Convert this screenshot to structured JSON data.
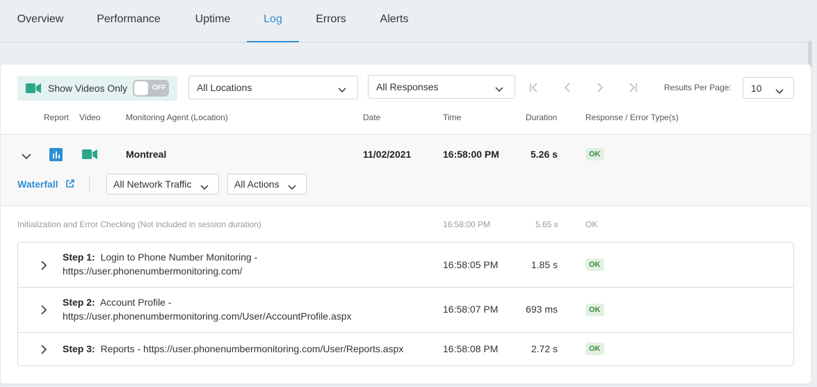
{
  "tabs": [
    {
      "label": "Overview"
    },
    {
      "label": "Performance"
    },
    {
      "label": "Uptime"
    },
    {
      "label": "Log"
    },
    {
      "label": "Errors"
    },
    {
      "label": "Alerts"
    }
  ],
  "toolbar": {
    "show_videos_label": "Show Videos Only",
    "toggle_state": "OFF",
    "locations": "All Locations",
    "responses": "All Responses",
    "results_per_page_label": "Results Per Page:",
    "results_per_page": "10"
  },
  "columns": {
    "report": "Report",
    "video": "Video",
    "agent": "Monitoring Agent (Location)",
    "date": "Date",
    "time": "Time",
    "duration": "Duration",
    "response": "Response / Error Type(s)"
  },
  "row": {
    "agent": "Montreal",
    "date": "11/02/2021",
    "time": "16:58:00 PM",
    "duration": "5.26 s",
    "status": "OK",
    "waterfall": "Waterfall",
    "network_filter": "All Network Traffic",
    "actions_filter": "All Actions"
  },
  "init": {
    "label": "Initialization and Error Checking (Not included in session duration)",
    "time": "16:58:00 PM",
    "duration": "5.65 s",
    "status": "OK"
  },
  "steps": [
    {
      "step": "Step 1:",
      "text": "Login to Phone Number Monitoring - https://user.phonenumbermonitoring.com/",
      "time": "16:58:05 PM",
      "duration": "1.85 s",
      "status": "OK"
    },
    {
      "step": "Step 2:",
      "text": "Account Profile - https://user.phonenumbermonitoring.com/User/AccountProfile.aspx",
      "time": "16:58:07 PM",
      "duration": "693 ms",
      "status": "OK"
    },
    {
      "step": "Step 3:",
      "text": "Reports - https://user.phonenumbermonitoring.com/User/Reports.aspx",
      "time": "16:58:08 PM",
      "duration": "2.72 s",
      "status": "OK"
    }
  ],
  "colors": {
    "accent": "#2d8fd5",
    "video_green": "#2aa889",
    "report_blue": "#2d8fd5",
    "ok_green": "#3d8a42"
  },
  "icons": {
    "video": "video-camera-icon",
    "report": "bar-chart-icon",
    "external": "external-link-icon",
    "pager_first": "first-page-icon",
    "pager_prev": "prev-page-icon",
    "pager_next": "next-page-icon",
    "pager_last": "last-page-icon"
  }
}
